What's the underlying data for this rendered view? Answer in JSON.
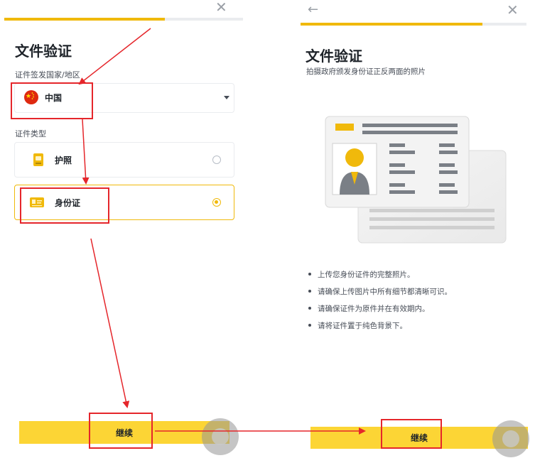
{
  "left_screen": {
    "close_icon": "✕",
    "title": "文件验证",
    "country_label": "证件签发国家/地区",
    "country_value": "中国",
    "doc_type_label": "证件类型",
    "options": [
      {
        "label": "护照",
        "selected": false
      },
      {
        "label": "身份证",
        "selected": true
      }
    ],
    "continue_label": "继续"
  },
  "right_screen": {
    "back_icon": "←",
    "close_icon": "✕",
    "title": "文件验证",
    "subtitle": "拍摄政府颁发身份证正反两面的照片",
    "bullets": [
      "上传您身份证件的完整照片。",
      "请确保上传图片中所有细节都清晰可识。",
      "请确保证件为原件并在有效期内。",
      "请将证件置于纯色背景下。"
    ],
    "continue_label": "继续"
  },
  "colors": {
    "brand_yellow": "#fcd535",
    "accent_yellow": "#f0b90b",
    "annotation_red": "#e5262b"
  }
}
